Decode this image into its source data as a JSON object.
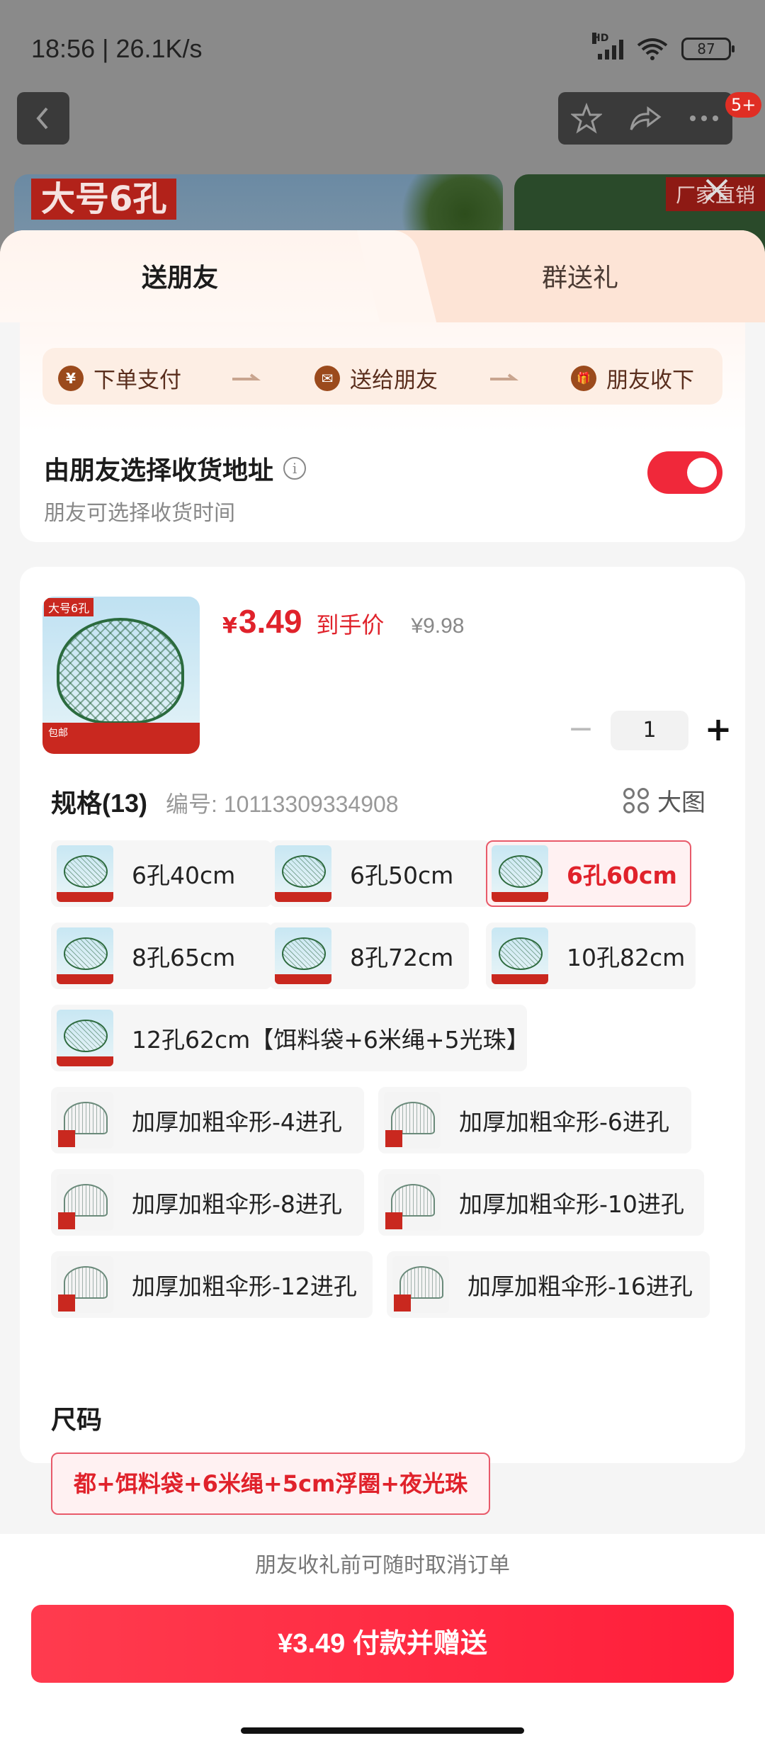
{
  "status": {
    "time": "18:56 | 26.1K/s",
    "battery": "87",
    "net_label": "HD"
  },
  "bg": {
    "badge": "5+",
    "hero_tag": "大号6孔",
    "hero_right_ribbon": "厂家直销"
  },
  "tabs": [
    {
      "label": "送朋友",
      "active": true
    },
    {
      "label": "群送礼",
      "active": false
    }
  ],
  "steps": [
    {
      "icon": "¥",
      "label": "下单支付"
    },
    {
      "icon": "✉",
      "label": "送给朋友"
    },
    {
      "icon": "🎁",
      "label": "朋友收下"
    }
  ],
  "address": {
    "title": "由朋友选择收货地址",
    "subtitle": "朋友可选择收货时间",
    "toggle_on": true
  },
  "product": {
    "thumb_tag": "大号6孔",
    "thumb_footer": "包邮",
    "currency": "¥",
    "price": "3.49",
    "price_label": "到手价",
    "original_price": "¥9.98",
    "quantity": "1"
  },
  "spec": {
    "title": "规格(13)",
    "code": "编号: 10113309334908",
    "big_image_label": "大图",
    "options": [
      {
        "label": "6孔40cm",
        "selected": false
      },
      {
        "label": "6孔50cm",
        "selected": false
      },
      {
        "label": "6孔60cm",
        "selected": true
      },
      {
        "label": "8孔65cm",
        "selected": false
      },
      {
        "label": "8孔72cm",
        "selected": false
      },
      {
        "label": "10孔82cm",
        "selected": false
      },
      {
        "label": "12孔62cm【饵料袋+6米绳+5光珠】",
        "selected": false
      },
      {
        "label": "加厚加粗伞形-4进孔",
        "selected": false
      },
      {
        "label": "加厚加粗伞形-6进孔",
        "selected": false
      },
      {
        "label": "加厚加粗伞形-8进孔",
        "selected": false
      },
      {
        "label": "加厚加粗伞形-10进孔",
        "selected": false
      },
      {
        "label": "加厚加粗伞形-12进孔",
        "selected": false
      },
      {
        "label": "加厚加粗伞形-16进孔",
        "selected": false
      }
    ]
  },
  "size": {
    "title": "尺码",
    "option": "都+饵料袋+6米绳+5cm浮圈+夜光珠"
  },
  "footer": {
    "note": "朋友收礼前可随时取消订单",
    "pay_label": "¥3.49 付款并赠送"
  },
  "colors": {
    "accent": "#e0222b",
    "pay_button": "#ff2a40",
    "toggle": "#f0283a"
  }
}
